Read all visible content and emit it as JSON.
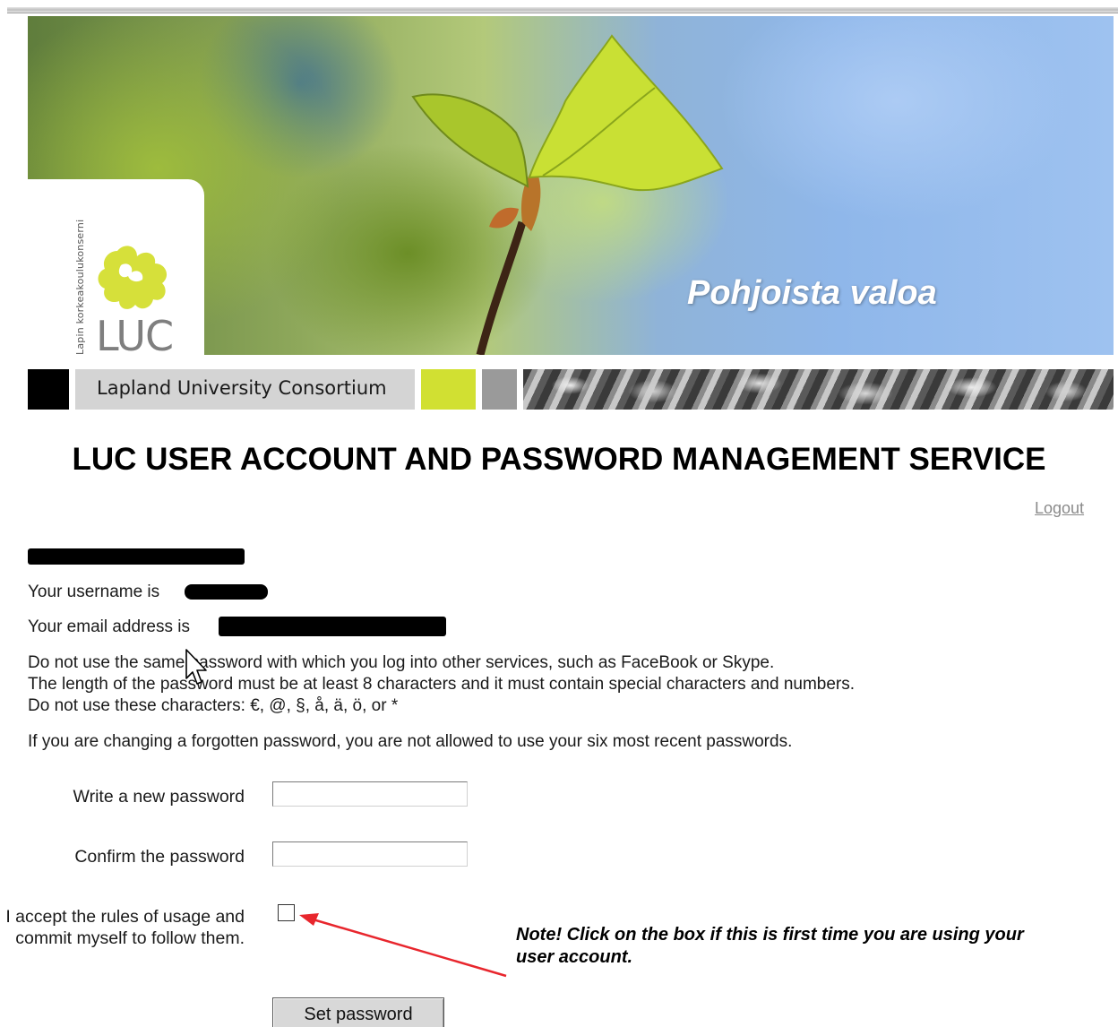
{
  "header": {
    "slogan": "Pohjoista valoa",
    "logo_vertical_text": "Lapin korkeakoulukonserni",
    "logo_text": "LUC",
    "consortium_name": "Lapland University Consortium"
  },
  "page": {
    "title": "LUC USER ACCOUNT AND PASSWORD MANAGEMENT SERVICE",
    "logout_label": "Logout"
  },
  "info": {
    "username_prefix": "Your username is",
    "email_prefix": "Your email address is",
    "rule_1": "Do not use the same password with which you log into other services, such as FaceBook or Skype.",
    "rule_2": "The length of the password must be at least 8 characters and it must contain special characters and numbers.",
    "rule_3": "Do not use these characters: €, @, §, å, ä, ö, or *",
    "forgotten_note": "If you are changing a forgotten password, you are not allowed to use your six most recent passwords."
  },
  "form": {
    "new_password_label": "Write a new password",
    "new_password_value": "",
    "confirm_password_label": "Confirm the password",
    "confirm_password_value": "",
    "accept_label": "I accept the rules of usage and commit myself to follow them.",
    "accept_checked": false,
    "submit_label": "Set password"
  },
  "annotation": {
    "note": "Note! Click on the box if this is first time you are using your user account.",
    "arrow_color": "#e8262d"
  },
  "colors": {
    "accent_green": "#d1e032",
    "stripe_grey": "#d4d4d4",
    "logo_yellow": "#d6e03a",
    "link_grey": "#8a8a8a"
  },
  "icons": {
    "logo": "luc-leaf-logo",
    "cursor": "mouse-pointer-icon",
    "arrow": "red-arrow-annotation"
  }
}
